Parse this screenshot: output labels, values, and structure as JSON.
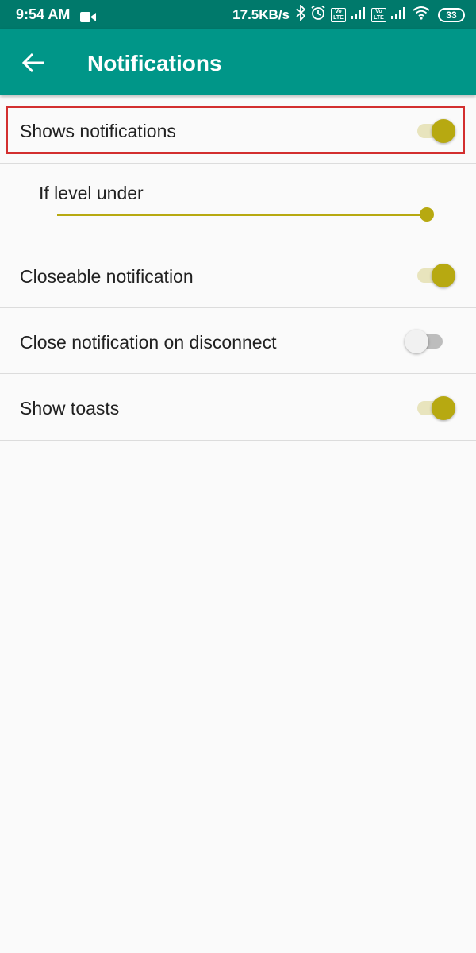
{
  "status_bar": {
    "time": "9:54 AM",
    "net_speed": "17.5KB/s",
    "volte_label": "Vo LTE",
    "battery": "33",
    "icons": [
      "video-icon",
      "bluetooth-icon",
      "alarm-icon",
      "signal-icon",
      "wifi-icon"
    ]
  },
  "app_bar": {
    "title": "Notifications",
    "back_icon": "arrow-left-icon"
  },
  "settings": {
    "shows_notifications": {
      "label": "Shows notifications",
      "enabled": true
    },
    "level_under": {
      "label": "If level under",
      "value_fraction": 1.0
    },
    "closeable_notification": {
      "label": "Closeable notification",
      "enabled": true
    },
    "close_on_disconnect": {
      "label": "Close notification on disconnect",
      "enabled": false
    },
    "show_toasts": {
      "label": "Show toasts",
      "enabled": true
    }
  },
  "colors": {
    "status_bar": "#00796b",
    "app_bar": "#009688",
    "accent": "#b7a911",
    "highlight": "#d32f2f"
  }
}
